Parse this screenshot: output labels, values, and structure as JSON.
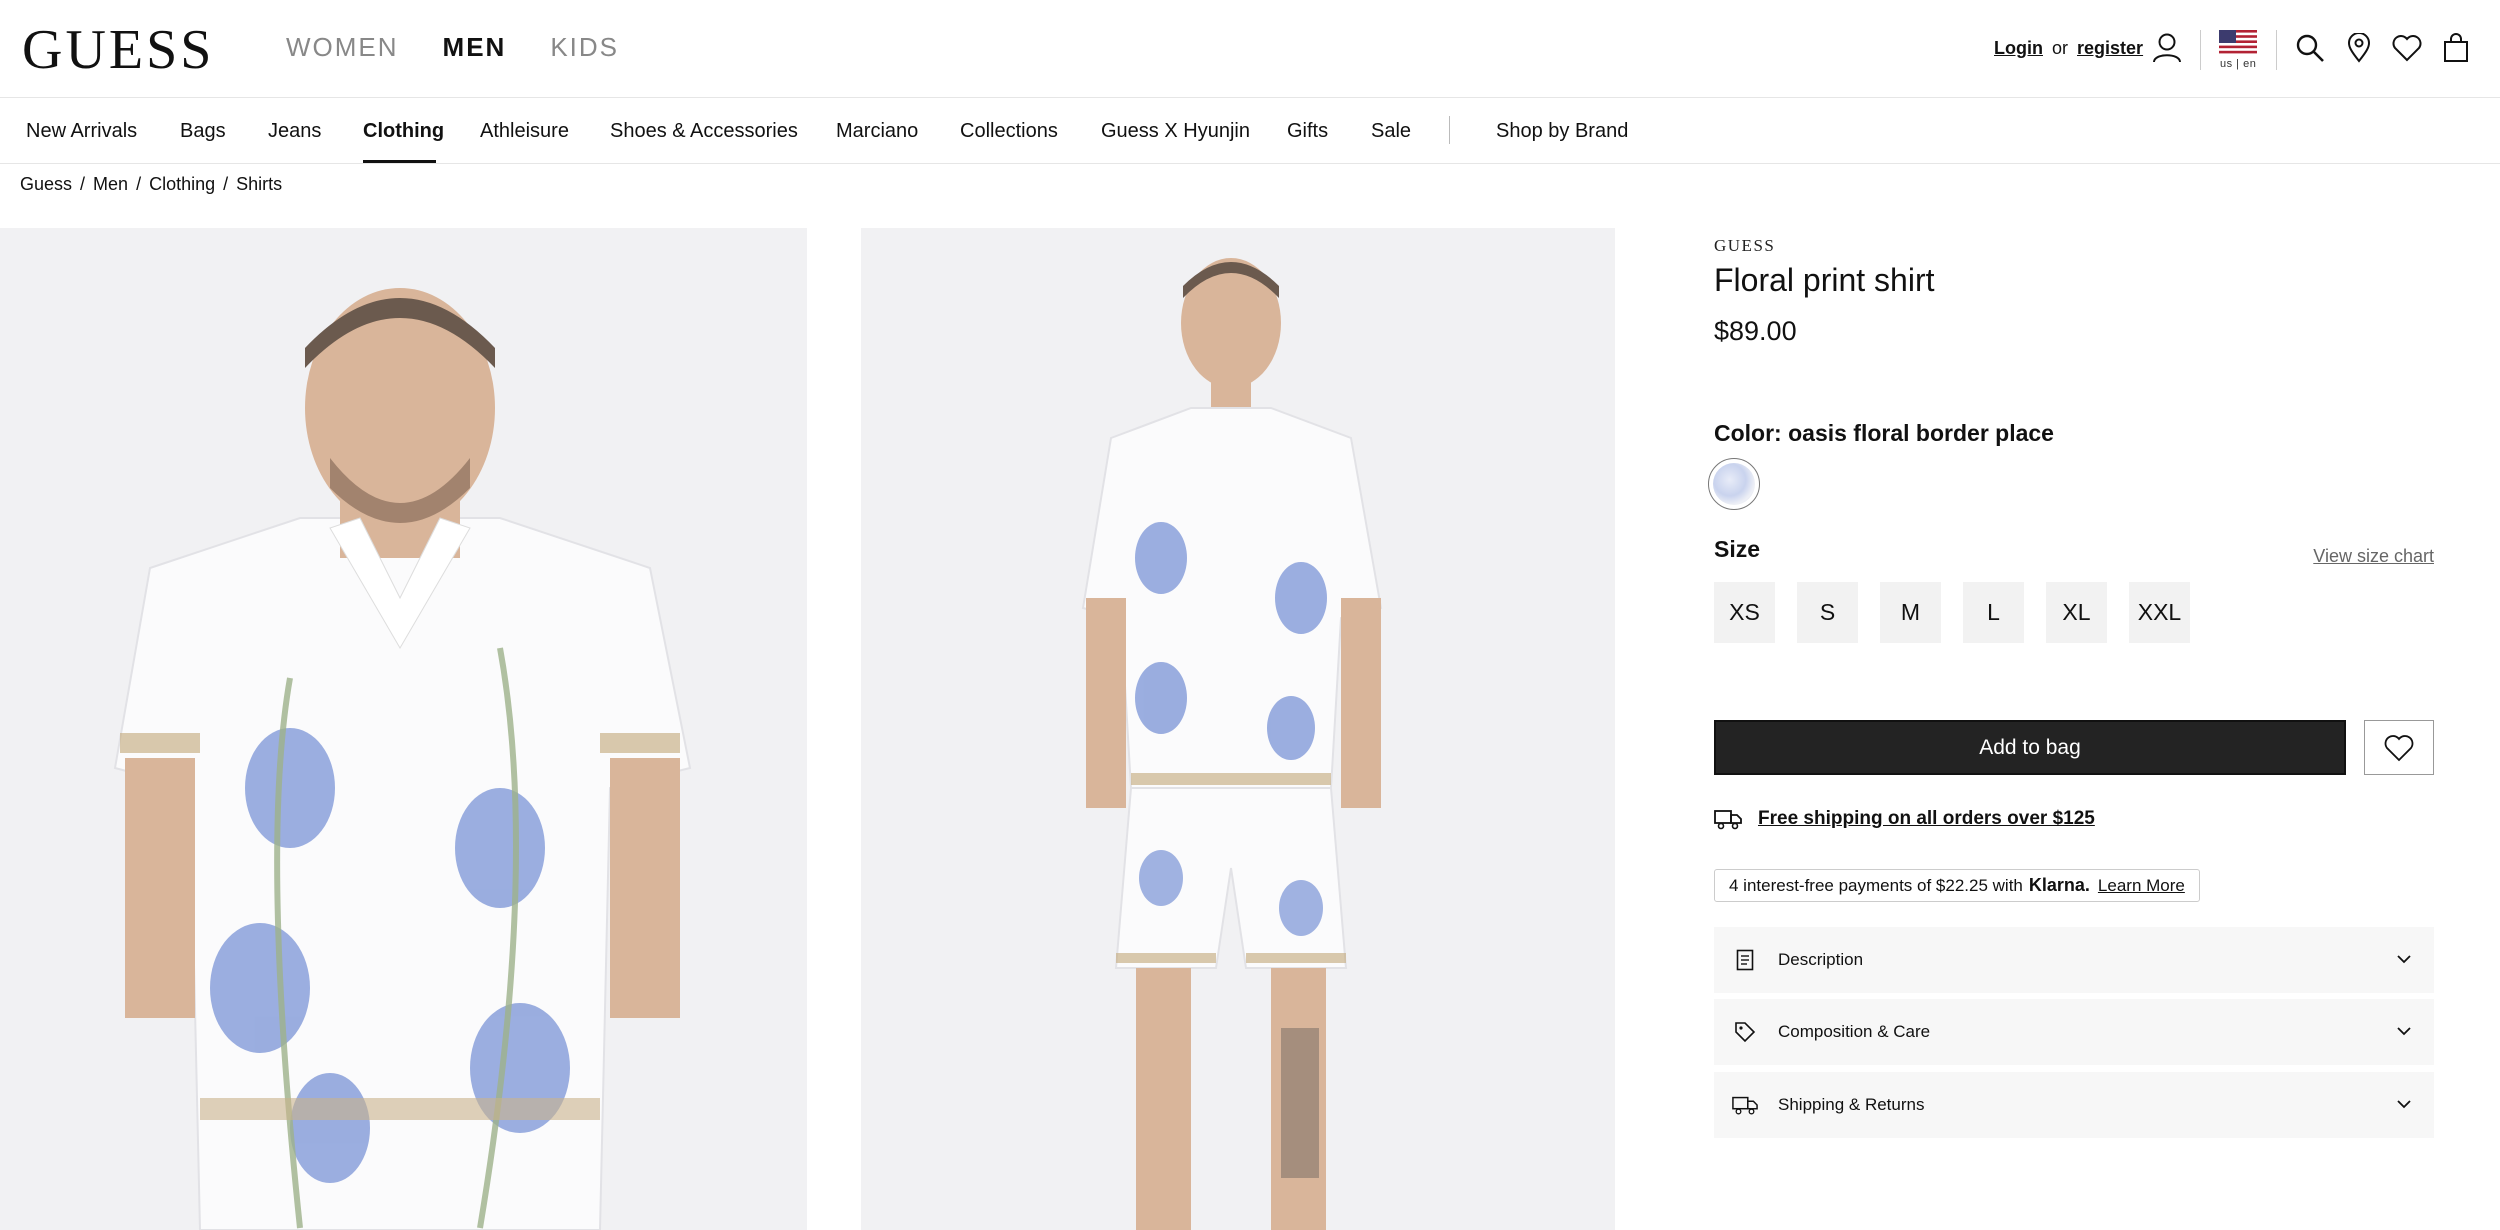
{
  "header": {
    "logo": "GUESS",
    "gender_tabs": [
      {
        "label": "WOMEN",
        "active": false
      },
      {
        "label": "MEN",
        "active": true
      },
      {
        "label": "KIDS",
        "active": false
      }
    ],
    "login_label": "Login",
    "or_label": "or",
    "register_label": "register",
    "locale": "us | en"
  },
  "nav": {
    "items": [
      {
        "label": "New Arrivals"
      },
      {
        "label": "Bags"
      },
      {
        "label": "Jeans"
      },
      {
        "label": "Clothing",
        "active": true
      },
      {
        "label": "Athleisure"
      },
      {
        "label": "Shoes & Accessories"
      },
      {
        "label": "Marciano"
      },
      {
        "label": "Collections"
      },
      {
        "label": "Guess X Hyunjin"
      },
      {
        "label": "Gifts"
      },
      {
        "label": "Sale"
      }
    ],
    "shop_by_brand": "Shop by Brand"
  },
  "breadcrumb": [
    "Guess",
    "Men",
    "Clothing",
    "Shirts"
  ],
  "product": {
    "brand": "GUESS",
    "title": "Floral print shirt",
    "price": "$89.00",
    "color_label": "Color: oasis floral border place",
    "size_label": "Size",
    "size_chart_label": "View size chart",
    "sizes": [
      "XS",
      "S",
      "M",
      "L",
      "XL",
      "XXL"
    ],
    "add_to_bag": "Add to bag",
    "shipping_text": "Free shipping on all orders over $125",
    "klarna": {
      "prefix": "4 interest-free payments of $22.25 with",
      "brand": "Klarna.",
      "link": "Learn More"
    },
    "accordions": [
      {
        "label": "Description",
        "icon": "document-icon"
      },
      {
        "label": "Composition & Care",
        "icon": "tag-icon"
      },
      {
        "label": "Shipping & Returns",
        "icon": "truck-icon"
      }
    ]
  },
  "colors": {
    "accent": "#111111",
    "button_bg": "#232323",
    "size_bg": "#f2f2f2",
    "accordion_bg": "#f7f7f7"
  }
}
